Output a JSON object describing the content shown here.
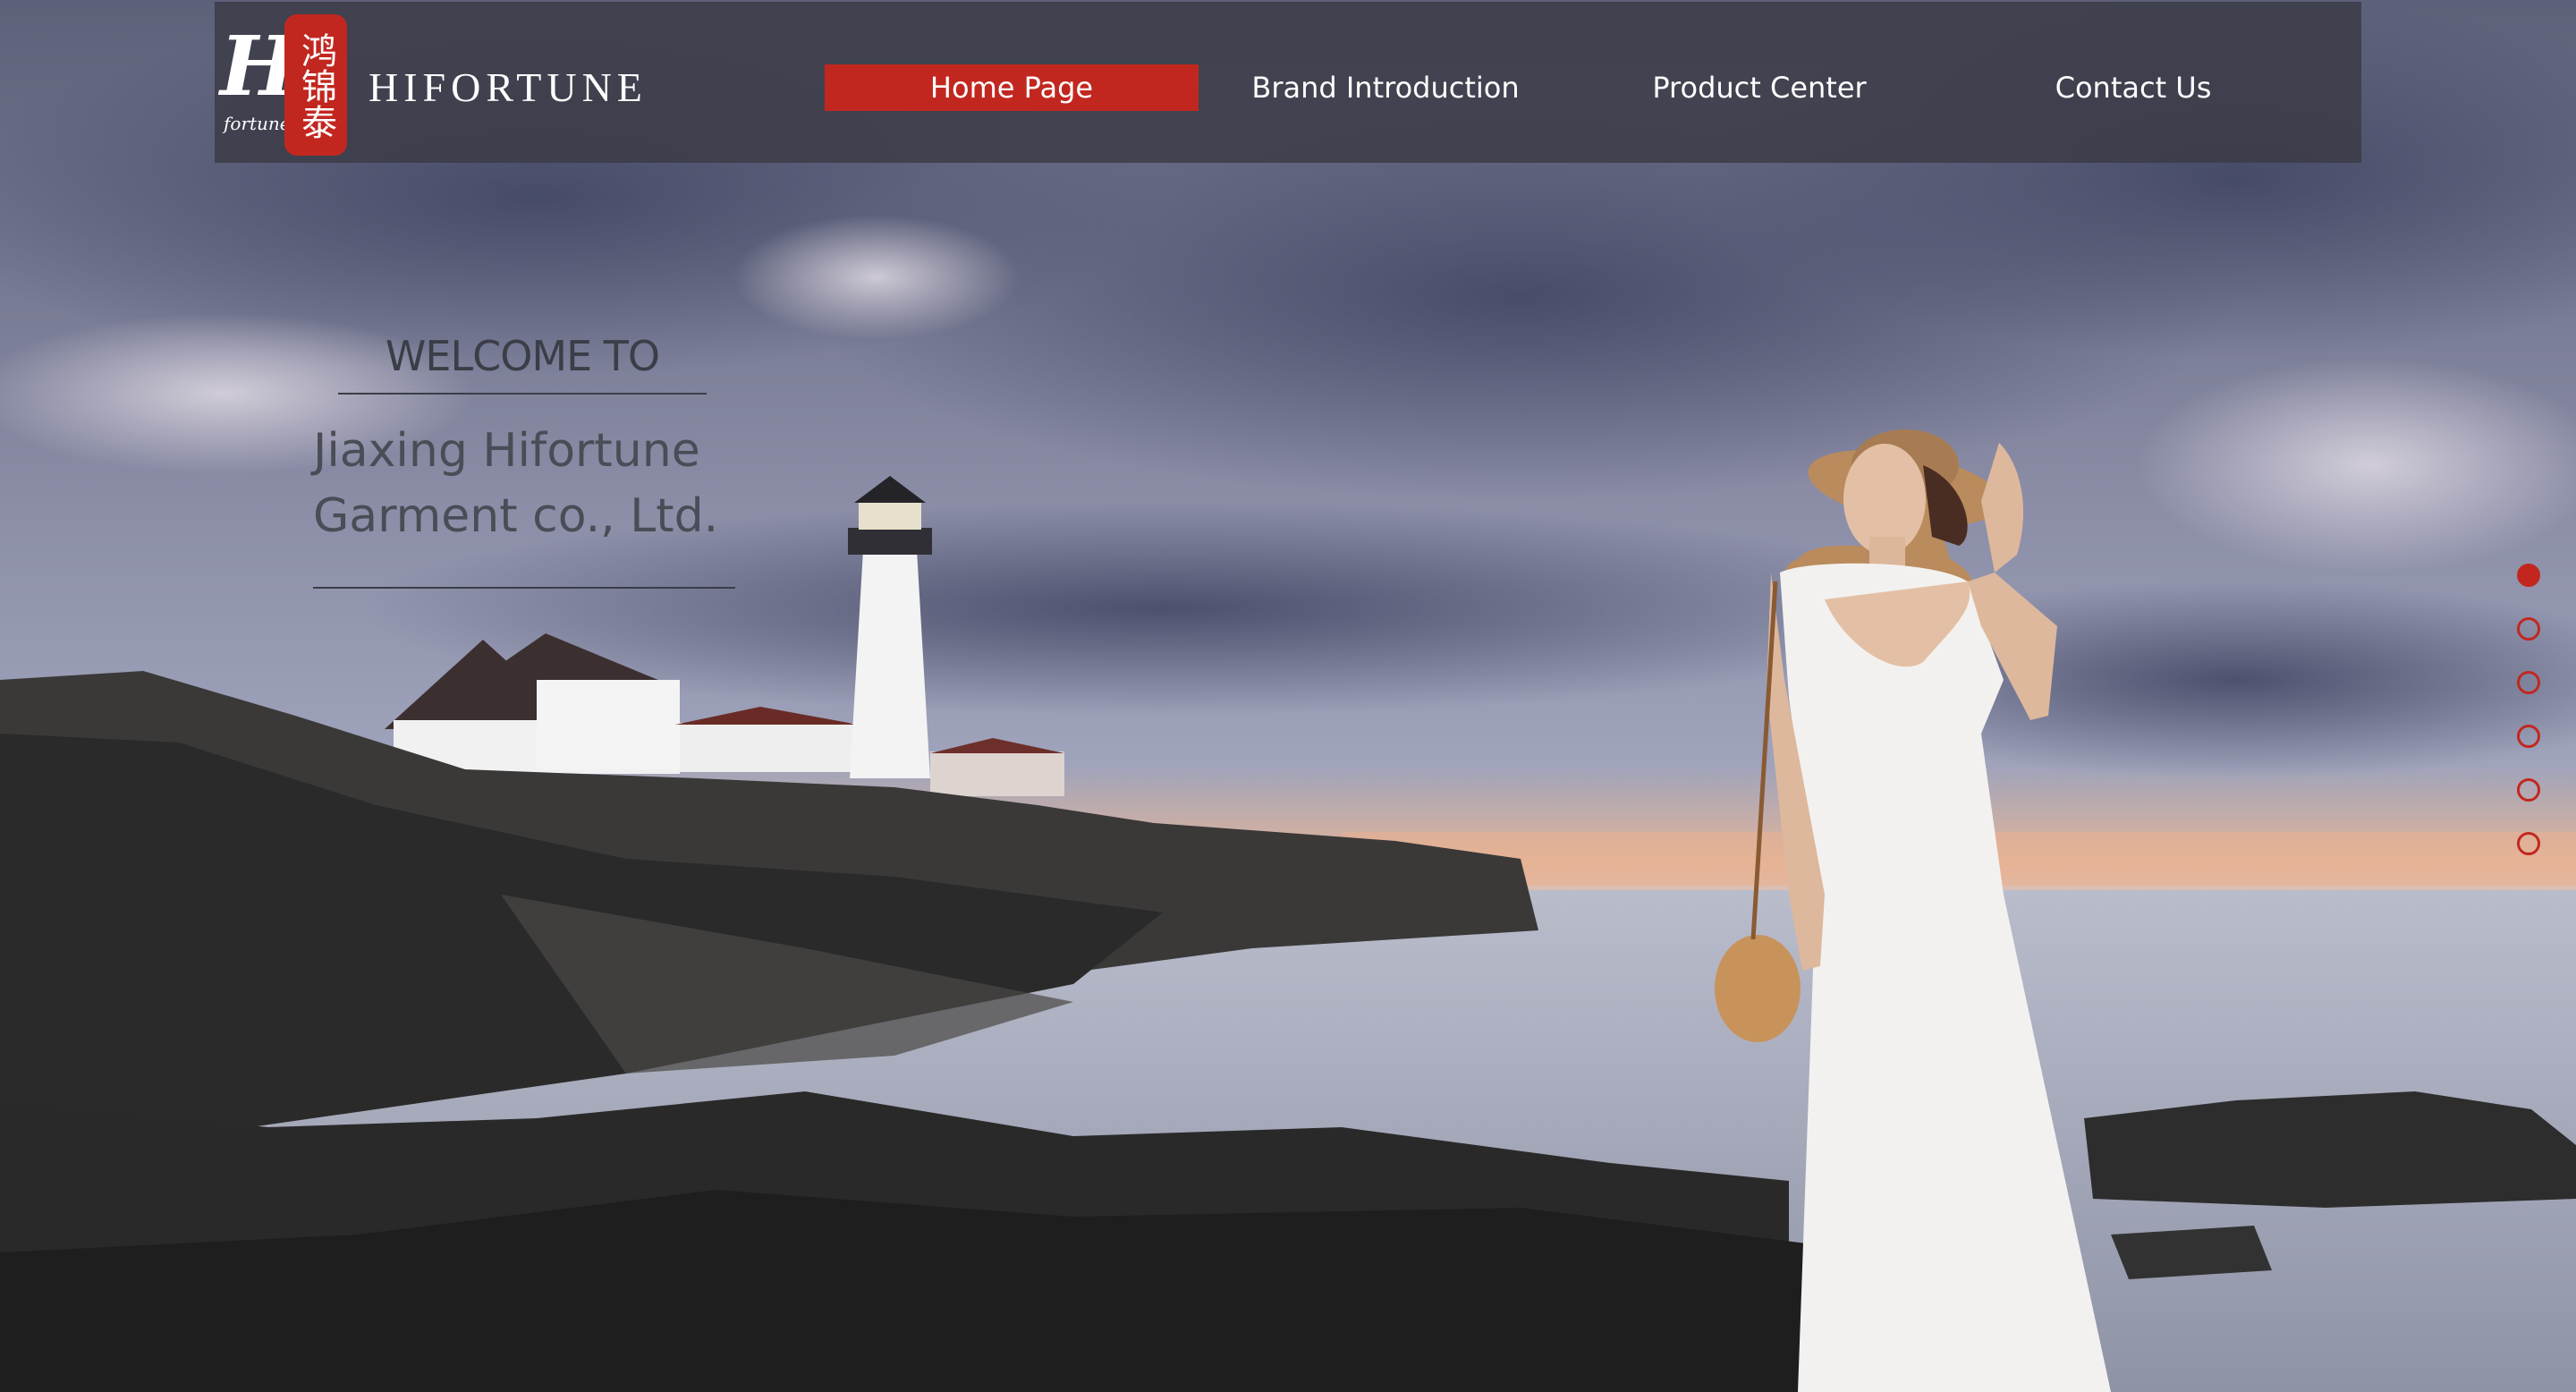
{
  "logo": {
    "mark_text": "Hi",
    "mark_subtext": "fortune",
    "seal_glyphs": "鸿锦泰",
    "brand_name": "HIFORTUNE"
  },
  "nav": {
    "items": [
      {
        "label": "Home Page",
        "active": true
      },
      {
        "label": "Brand Introduction",
        "active": false
      },
      {
        "label": "Product Center",
        "active": false
      },
      {
        "label": "Contact Us",
        "active": false
      }
    ]
  },
  "hero": {
    "welcome": "WELCOME TO",
    "company_line1": "Jiaxing Hifortune",
    "company_line2": "Garment co., Ltd."
  },
  "slider": {
    "slide_count": 6,
    "active_index": 0
  },
  "colors": {
    "accent_red": "#c2271f",
    "nav_bar": "#3a3a46",
    "hero_text": "#3b3d47"
  }
}
